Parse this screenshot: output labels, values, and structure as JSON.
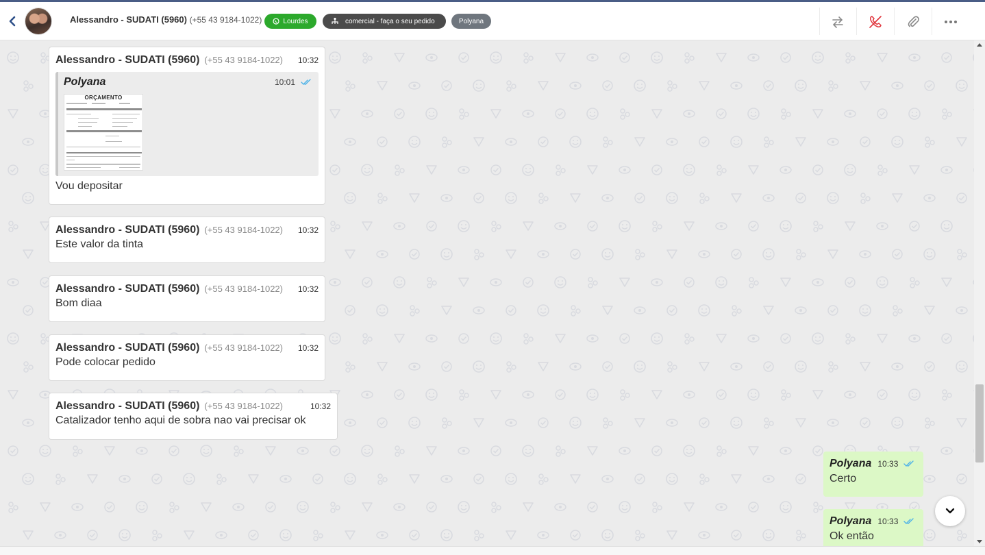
{
  "header": {
    "contact_name": "Alessandro - SUDATI (5960)",
    "contact_phone": "(+55 43 9184-1022)",
    "tags": [
      {
        "label": "Lourdes",
        "icon": "whatsapp-icon",
        "color": "#2ca92c"
      },
      {
        "label": "comercial - faça o seu pedido",
        "icon": "department-icon",
        "color": "#4b4b4b"
      },
      {
        "label": "Polyana",
        "color": "#6f767e"
      }
    ],
    "actions": [
      "transfer-icon",
      "end-call-icon",
      "attach-icon",
      "more-icon"
    ]
  },
  "messages": [
    {
      "sender": "Alessandro - SUDATI (5960)",
      "phone": "(+55 43 9184-1022)",
      "time": "10:32",
      "quote": {
        "sender": "Polyana",
        "time": "10:01",
        "attachment_title": "ORÇAMENTO"
      },
      "text": "Vou depositar"
    },
    {
      "sender": "Alessandro - SUDATI (5960)",
      "phone": "(+55 43 9184-1022)",
      "time": "10:32",
      "text": "Este valor da tinta"
    },
    {
      "sender": "Alessandro - SUDATI (5960)",
      "phone": "(+55 43 9184-1022)",
      "time": "10:32",
      "text": "Bom diaa"
    },
    {
      "sender": "Alessandro - SUDATI (5960)",
      "phone": "(+55 43 9184-1022)",
      "time": "10:32",
      "text": "Pode colocar pedido"
    },
    {
      "sender": "Alessandro - SUDATI (5960)",
      "phone": "(+55 43 9184-1022)",
      "time": "10:32",
      "text": "Catalizador tenho aqui de sobra nao vai precisar ok"
    }
  ],
  "outgoing": [
    {
      "sender": "Polyana",
      "time": "10:33",
      "text": "Certo"
    },
    {
      "sender": "Polyana",
      "time": "10:33",
      "text": "Ok então"
    }
  ],
  "colors": {
    "outgoing_bubble": "#dcf8c6",
    "chat_background": "#ececec",
    "read_check": "#4fb3e8"
  }
}
